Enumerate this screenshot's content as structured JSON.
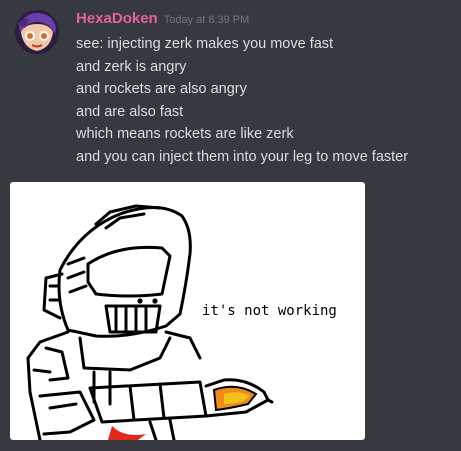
{
  "message": {
    "username": "HexaDoken",
    "timestamp": "Today at 8:39 PM",
    "lines": [
      "see: injecting zerk makes you move fast",
      "and zerk is angry",
      "and rockets are also angry",
      "and are also fast",
      "which means rockets are like zerk",
      "and you can inject them into your leg to move faster"
    ],
    "attachment": {
      "caption": "it's not working"
    }
  },
  "colors": {
    "background": "#36393f",
    "username": "#e95fa0",
    "timestamp": "#72767d",
    "text": "#dcddde"
  }
}
